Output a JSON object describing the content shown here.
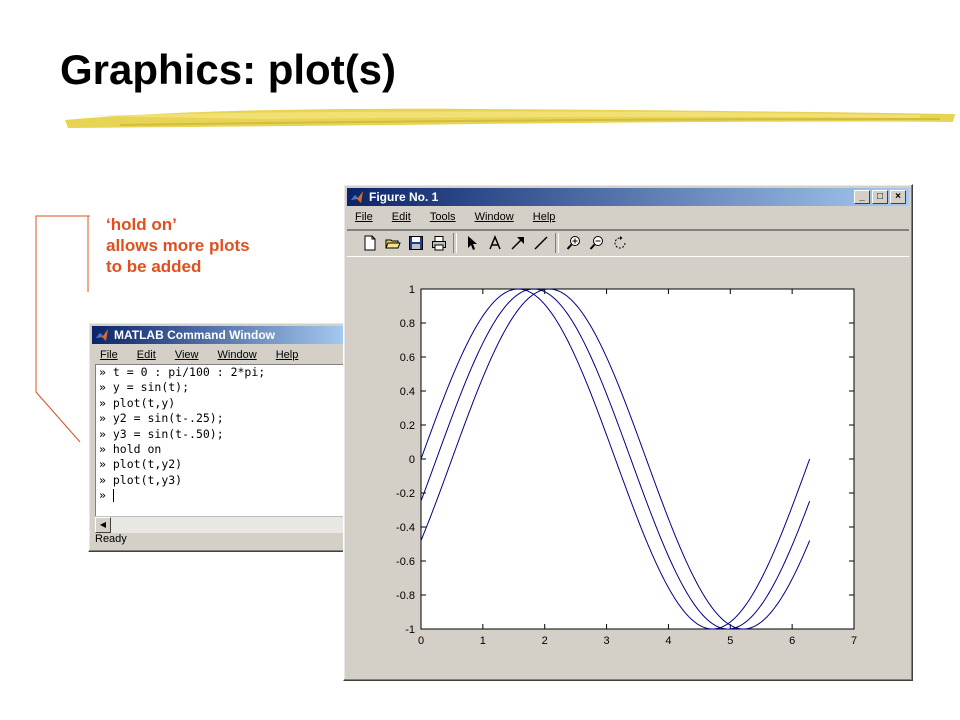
{
  "slide": {
    "title": "Graphics: plot(s)",
    "note_lines": [
      "‘hold on’",
      "allows more plots",
      "to be added"
    ],
    "note_color": "#e0501f"
  },
  "command_window": {
    "title": "MATLAB Command Window",
    "menu": [
      "File",
      "Edit",
      "View",
      "Window",
      "Help"
    ],
    "prompt": "»",
    "lines": [
      "t = 0 : pi/100 : 2*pi;",
      "y = sin(t);",
      "plot(t,y)",
      "y2 = sin(t-.25);",
      "y3 = sin(t-.50);",
      "hold on",
      "plot(t,y2)",
      "plot(t,y3)",
      ""
    ],
    "status": "Ready"
  },
  "figure_window": {
    "title": "Figure No. 1",
    "menu": [
      "File",
      "Edit",
      "Tools",
      "Window",
      "Help"
    ],
    "toolbar_icons": [
      "new-file-icon",
      "open-folder-icon",
      "save-icon",
      "print-icon",
      "pointer-icon",
      "text-icon",
      "arrow-icon",
      "line-icon",
      "zoom-in-icon",
      "zoom-out-icon",
      "rotate-icon"
    ],
    "title_buttons": [
      "minimize-icon",
      "maximize-icon",
      "close-icon"
    ]
  },
  "chart_data": {
    "type": "line",
    "title": "",
    "xlabel": "",
    "ylabel": "",
    "xlim": [
      0,
      7
    ],
    "ylim": [
      -1,
      1
    ],
    "xticks": [
      "0",
      "1",
      "2",
      "3",
      "4",
      "5",
      "6",
      "7"
    ],
    "yticks": [
      "-1",
      "-0.8",
      "-0.6",
      "-0.4",
      "-0.2",
      "0",
      "0.2",
      "0.4",
      "0.6",
      "0.8",
      "1"
    ],
    "grid": false,
    "line_color": "#00008b",
    "x_range": [
      0,
      6.2832
    ],
    "samples": 201,
    "series": [
      {
        "expression": "sin(t)",
        "phase_shift": 0
      },
      {
        "expression": "sin(t-.25)",
        "phase_shift": 0.25
      },
      {
        "expression": "sin(t-.50)",
        "phase_shift": 0.5
      }
    ]
  },
  "colors": {
    "titlebar_start": "#0a246a",
    "titlebar_end": "#a6caf0",
    "window_face": "#d4d0c8",
    "brush": "#e8d44a"
  }
}
